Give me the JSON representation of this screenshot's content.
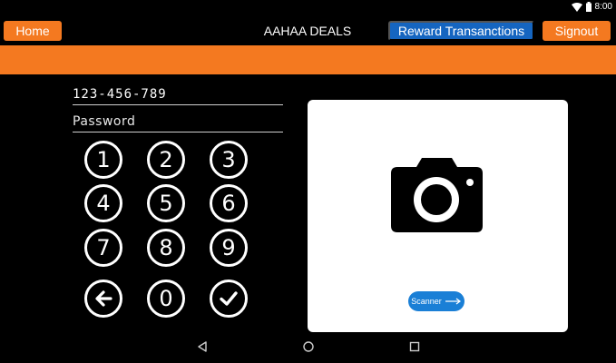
{
  "status_bar": {
    "time": "8:00",
    "icons": [
      "wifi-icon",
      "battery-icon"
    ]
  },
  "header": {
    "home_label": "Home",
    "title": "AAHAA DEALS",
    "reward_label": "Reward Transanctions",
    "signout_label": "Signout"
  },
  "form": {
    "id_value": "123-456-789",
    "password_placeholder": "Password"
  },
  "keypad": {
    "keys": [
      "1",
      "2",
      "3",
      "4",
      "5",
      "6",
      "7",
      "8",
      "9",
      "backspace",
      "0",
      "confirm"
    ]
  },
  "scanner": {
    "icon": "camera-icon",
    "button_label": "Scanner"
  },
  "nav_bar": {
    "icons": [
      "back-icon",
      "home-icon",
      "recents-icon"
    ]
  },
  "colors": {
    "orange": "#f47920",
    "blue": "#1565c0",
    "background": "#000000"
  }
}
